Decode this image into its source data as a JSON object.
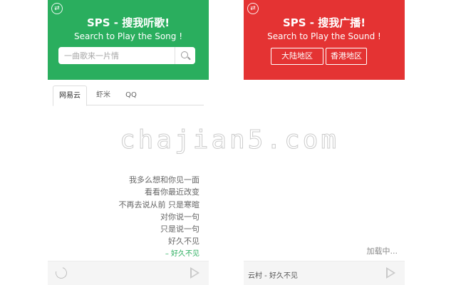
{
  "song_panel": {
    "title": "SPS - 搜我听歌!",
    "subtitle": "Search to Play the Song !",
    "search_placeholder": "一曲歌来一片情",
    "tabs": [
      {
        "label": "网易云",
        "active": true
      },
      {
        "label": "虾米",
        "active": false
      },
      {
        "label": "QQ",
        "active": false
      }
    ],
    "lyrics": [
      "我多么想和你见一面",
      "看看你最近改变",
      "不再去说从前 只是寒暄",
      "对你说一句",
      "只是说一句",
      "好久不见"
    ],
    "current_line": "– 好久不见",
    "header_color": "#2aae5e"
  },
  "sound_panel": {
    "title": "SPS - 搜我广播!",
    "subtitle": "Search to Play the Sound !",
    "regions": [
      "大陆地区",
      "香港地区"
    ],
    "loading_text": "加载中...",
    "now_playing": "云村 - 好久不见",
    "header_color": "#e43333"
  },
  "watermark": "chajian5.com",
  "icons": {
    "swap": "swap-icon",
    "search": "search-icon",
    "replay": "replay-icon",
    "play": "play-icon"
  }
}
